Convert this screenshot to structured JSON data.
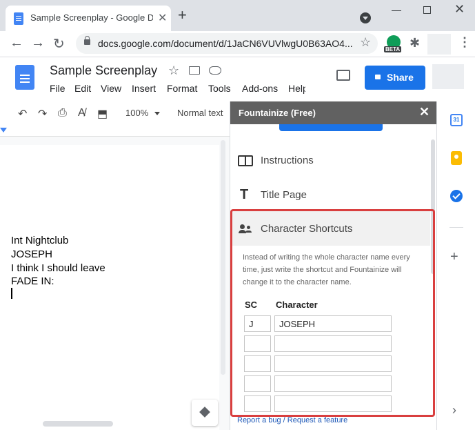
{
  "browser": {
    "tab_title": "Sample Screenplay - Google Docs",
    "tab_close": "✕",
    "new_tab": "+",
    "url": "docs.google.com/document/d/1JaCN6VUVlwgU0B63AO4...",
    "extension_badge": "BETA",
    "window_min": "—",
    "window_close": "✕",
    "nav": {
      "back": "←",
      "forward": "→",
      "reload": "↻"
    },
    "star": "☆",
    "puzzle": "✱",
    "kebab": "⋮"
  },
  "docs": {
    "title": "Sample Screenplay",
    "title_star": "☆",
    "menu": [
      "File",
      "Edit",
      "View",
      "Insert",
      "Format",
      "Tools",
      "Add-ons",
      "Help"
    ],
    "share_label": "Share",
    "zoom": "100%",
    "style": "Normal text",
    "toolbar_icons": {
      "undo": "↶",
      "redo": "↷",
      "print": "⎙",
      "spell": "A̸",
      "paint": "⬒"
    },
    "lines": [
      "Int Nightclub",
      "JOSEPH",
      "I think I should leave",
      "FADE IN:"
    ]
  },
  "sidebar": {
    "title": "Fountainize (Free)",
    "close": "✕",
    "items": [
      {
        "label": "Instructions",
        "icon": "book-icon"
      },
      {
        "label": "Title Page",
        "icon": "title-t-icon"
      },
      {
        "label": "Character Shortcuts",
        "icon": "people-icon"
      }
    ],
    "description": "Instead of writing the whole character name every time, just write the shortcut and Fountainize will change it to the character name.",
    "columns": {
      "sc": "SC",
      "character": "Character"
    },
    "shortcuts": [
      {
        "sc": "J",
        "character": "JOSEPH"
      },
      {
        "sc": "",
        "character": ""
      },
      {
        "sc": "",
        "character": ""
      },
      {
        "sc": "",
        "character": ""
      },
      {
        "sc": "",
        "character": ""
      }
    ],
    "report_link": "Report a bug / Request a feature"
  },
  "side_panel": {
    "calendar_day": "31",
    "add": "+",
    "expand": "›"
  },
  "colors": {
    "accent": "#1a73e8",
    "highlight": "#d93f3f",
    "sidebar_header": "#616161"
  }
}
